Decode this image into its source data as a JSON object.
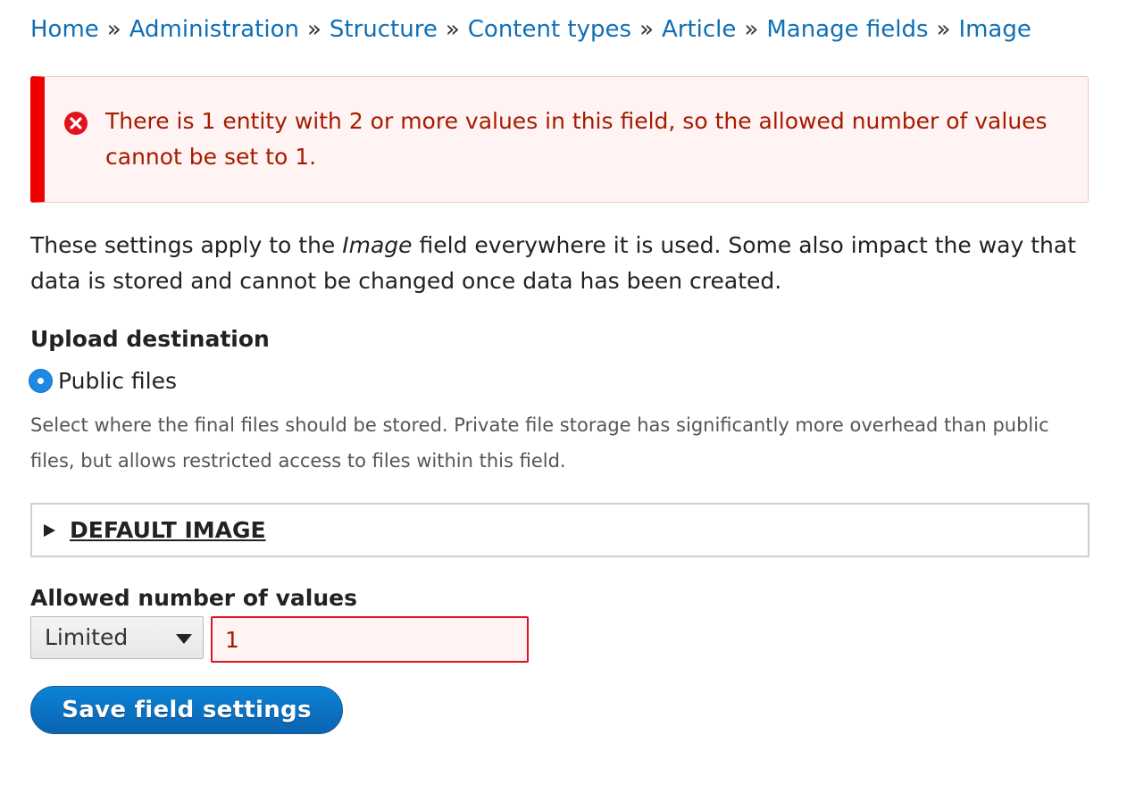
{
  "breadcrumb": {
    "items": [
      "Home",
      "Administration",
      "Structure",
      "Content types",
      "Article",
      "Manage fields",
      "Image"
    ],
    "separator": "»"
  },
  "error": {
    "icon": "error-circle-x-icon",
    "message": "There is 1 entity with 2 or more values in this field, so the allowed number of values cannot be set to 1."
  },
  "description": {
    "before": "These settings apply to the ",
    "emphasis": "Image",
    "after": " field everywhere it is used. Some also impact the way that data is stored and cannot be changed once data has been created."
  },
  "upload_destination": {
    "label": "Upload destination",
    "option_label": "Public files",
    "help": "Select where the final files should be stored. Private file storage has significantly more overhead than public files, but allows restricted access to files within this field."
  },
  "default_image": {
    "summary": "DEFAULT IMAGE"
  },
  "allowed_values": {
    "label": "Allowed number of values",
    "select_value": "Limited",
    "number_value": "1"
  },
  "actions": {
    "save_label": "Save field settings"
  },
  "colors": {
    "link": "#0f6fb6",
    "error_text": "#a51b00",
    "error_accent": "#ee0000",
    "button": "#0a6fc2"
  }
}
